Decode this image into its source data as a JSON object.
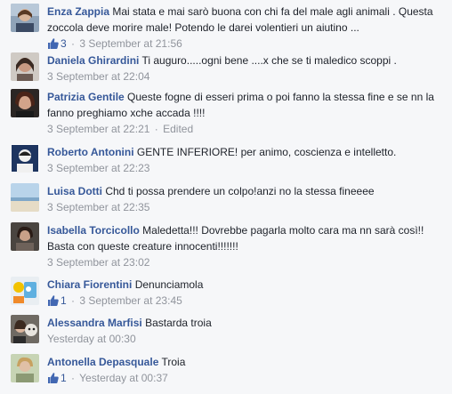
{
  "comments": [
    {
      "author": "Enza Zappia",
      "text": "Mai stata e mai sarò buona con chi fa del male agli animali . Questa zoccola deve morire male! Potendo le darei volentieri un aiutino ...",
      "likes": "3",
      "timestamp": "3 September at 21:56",
      "edited": ""
    },
    {
      "author": "Daniela Ghirardini",
      "text": "Ti auguro.....ogni bene ....x che se ti maledico scoppi .",
      "likes": "",
      "timestamp": "3 September at 22:04",
      "edited": ""
    },
    {
      "author": "Patrizia Gentile",
      "text": "Queste fogne di esseri prima o poi fanno la stessa fine e se nn la fanno preghiamo xche accada !!!!",
      "likes": "",
      "timestamp": "3 September at 22:21",
      "edited": "Edited"
    },
    {
      "author": "Roberto Antonini",
      "text": "GENTE INFERIORE! per animo, coscienza e intelletto.",
      "likes": "",
      "timestamp": "3 September at 22:23",
      "edited": ""
    },
    {
      "author": "Luisa Dotti",
      "text": "Chd ti possa prendere un colpo!anzi no la stessa fineeee",
      "likes": "",
      "timestamp": "3 September at 22:35",
      "edited": ""
    },
    {
      "author": "Isabella Torcicollo",
      "text": "Maledetta!!! Dovrebbe pagarla molto cara ma nn sarà così!! Basta con queste creature innocenti!!!!!!!",
      "likes": "",
      "timestamp": "3 September at 23:02",
      "edited": ""
    },
    {
      "author": "Chiara Fiorentini",
      "text": "Denunciamola",
      "likes": "1",
      "timestamp": "3 September at 23:45",
      "edited": ""
    },
    {
      "author": "Alessandra Marfisi",
      "text": "Bastarda troia",
      "likes": "",
      "timestamp": "Yesterday at 00:30",
      "edited": ""
    },
    {
      "author": "Antonella Depasquale",
      "text": "Troia",
      "likes": "1",
      "timestamp": "Yesterday at 00:37",
      "edited": ""
    }
  ],
  "colors": {
    "author": "#365899",
    "meta": "#90949c",
    "text": "#1d2129",
    "background": "#f6f7f9"
  },
  "icons": {
    "like": "thumbs-up-icon"
  }
}
